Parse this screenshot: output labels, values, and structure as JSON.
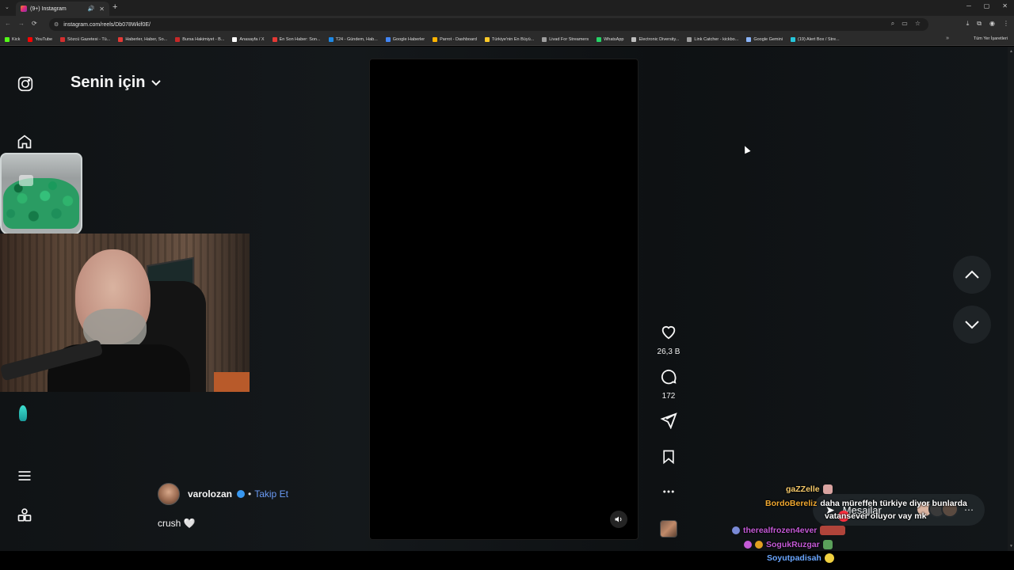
{
  "browser": {
    "tab_title": "(9+) Instagram",
    "url": "instagram.com/reels/Db078Wkif0E/",
    "bookmarks": [
      {
        "label": "Kick",
        "color": "#53fc18"
      },
      {
        "label": "YouTube",
        "color": "#ff0000"
      },
      {
        "label": "Sözcü Gazetesi - Tü...",
        "color": "#d32f2f"
      },
      {
        "label": "Haberler, Haber, So...",
        "color": "#e53935"
      },
      {
        "label": "Bursa Hakimiyet - B...",
        "color": "#c62828"
      },
      {
        "label": "Anasayfa / X",
        "color": "#ffffff"
      },
      {
        "label": "En Son Haber: Son...",
        "color": "#e53935"
      },
      {
        "label": "T24 - Gündem, Hab...",
        "color": "#1e88e5"
      },
      {
        "label": "Google Haberler",
        "color": "#4285f4"
      },
      {
        "label": "Parrot - Dashboard",
        "color": "#ffb300"
      },
      {
        "label": "Türkiye'nin En Büyü...",
        "color": "#ffca28"
      },
      {
        "label": "Livad For Streamers",
        "color": "#9e9e9e"
      },
      {
        "label": "WhatsApp",
        "color": "#25d366"
      },
      {
        "label": "Electronic Diversity...",
        "color": "#bdbdbd"
      },
      {
        "label": "Link Catcher - kickbo...",
        "color": "#9e9e9e"
      },
      {
        "label": "Google Gemini",
        "color": "#8ab4f8"
      },
      {
        "label": "(19) Alert Box / Stre...",
        "color": "#26c6da"
      }
    ],
    "all_bookmarks": "Tüm Yer İşaretleri"
  },
  "feed": {
    "title": "Senin için"
  },
  "post": {
    "author": "varolozan",
    "separator": "•",
    "follow_label": "Takip Et",
    "caption": "crush 🤍",
    "likes": "26,3 B",
    "comments": "172"
  },
  "messages": {
    "label": "Mesajlar"
  },
  "chat": [
    {
      "user": "gaZZelle",
      "user_color": "#f5c96a",
      "message": ""
    },
    {
      "user": "BordoBereliz",
      "user_color": "#f0a830",
      "message": "daha müreffeh türkiye diyor bunlarda"
    },
    {
      "user": "",
      "user_color": "#ffffff",
      "message": "vatansever oluyor vay mk"
    },
    {
      "user": "therealfrozen4ever",
      "user_color": "#c45ad6",
      "message": ""
    },
    {
      "user": "SogukRuzgar",
      "user_color": "#c45ad6",
      "message": ""
    },
    {
      "user": "Soyutpadisah",
      "user_color": "#6aa6ff",
      "message": ""
    }
  ],
  "colors": {
    "accent_follow": "#6a9bf6",
    "notification": "#ff3040"
  }
}
